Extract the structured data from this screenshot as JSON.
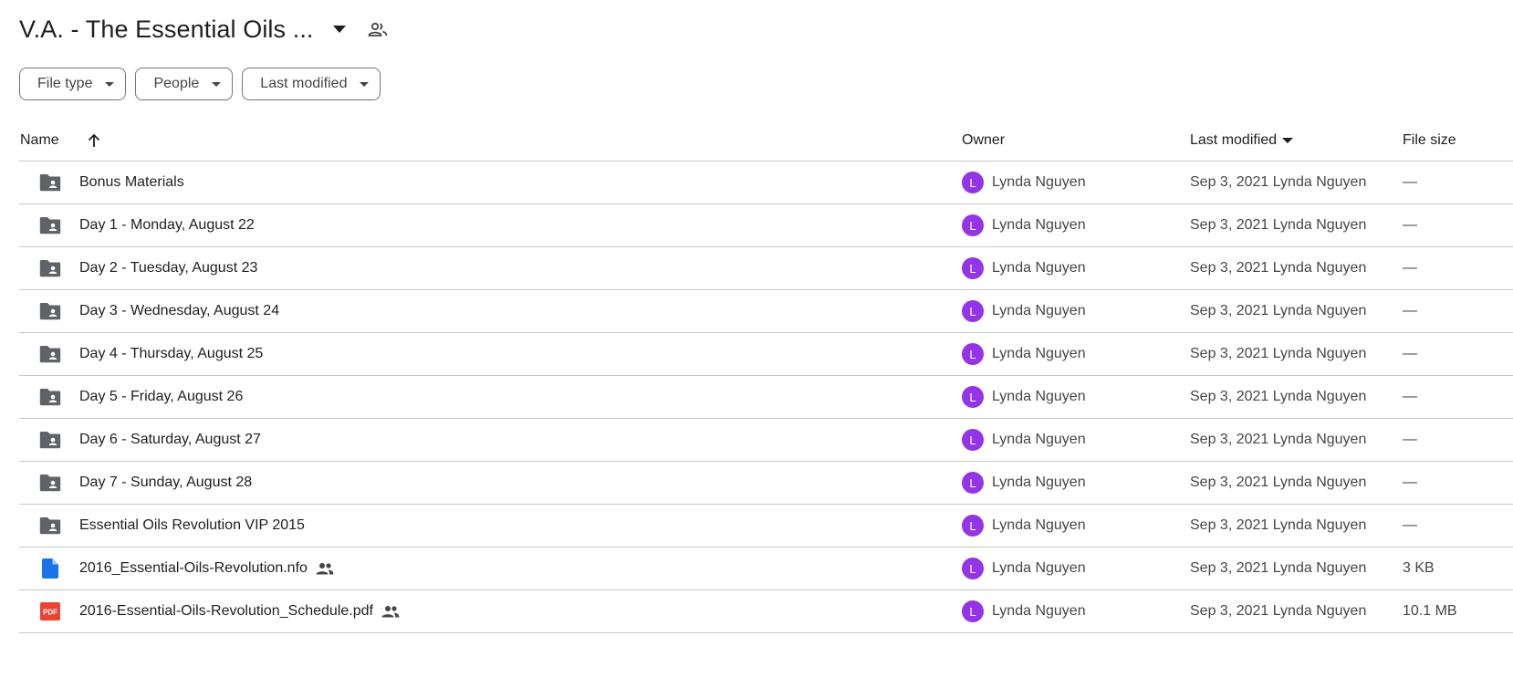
{
  "header": {
    "title": "V.A. - The Essential Oils ...",
    "title_caret_icon": "arrow-drop-down-icon",
    "shared_icon": "people-icon"
  },
  "filters": [
    {
      "label": "File type"
    },
    {
      "label": "People"
    },
    {
      "label": "Last modified"
    }
  ],
  "table": {
    "columns": {
      "name": "Name",
      "owner": "Owner",
      "last_modified": "Last modified",
      "file_size": "File size"
    },
    "rows": [
      {
        "name": "Bonus Materials",
        "type": "shared-folder",
        "shared": false,
        "owner_initial": "L",
        "owner": "Lynda Nguyen",
        "modified": "Sep 3, 2021 Lynda Nguyen",
        "size": "—"
      },
      {
        "name": "Day 1 - Monday, August 22",
        "type": "shared-folder",
        "shared": false,
        "owner_initial": "L",
        "owner": "Lynda Nguyen",
        "modified": "Sep 3, 2021 Lynda Nguyen",
        "size": "—"
      },
      {
        "name": "Day 2 - Tuesday, August 23",
        "type": "shared-folder",
        "shared": false,
        "owner_initial": "L",
        "owner": "Lynda Nguyen",
        "modified": "Sep 3, 2021 Lynda Nguyen",
        "size": "—"
      },
      {
        "name": "Day 3 - Wednesday, August 24",
        "type": "shared-folder",
        "shared": false,
        "owner_initial": "L",
        "owner": "Lynda Nguyen",
        "modified": "Sep 3, 2021 Lynda Nguyen",
        "size": "—"
      },
      {
        "name": "Day 4 - Thursday, August 25",
        "type": "shared-folder",
        "shared": false,
        "owner_initial": "L",
        "owner": "Lynda Nguyen",
        "modified": "Sep 3, 2021 Lynda Nguyen",
        "size": "—"
      },
      {
        "name": "Day 5 - Friday, August 26",
        "type": "shared-folder",
        "shared": false,
        "owner_initial": "L",
        "owner": "Lynda Nguyen",
        "modified": "Sep 3, 2021 Lynda Nguyen",
        "size": "—"
      },
      {
        "name": "Day 6 - Saturday, August 27",
        "type": "shared-folder",
        "shared": false,
        "owner_initial": "L",
        "owner": "Lynda Nguyen",
        "modified": "Sep 3, 2021 Lynda Nguyen",
        "size": "—"
      },
      {
        "name": "Day 7 - Sunday, August 28",
        "type": "shared-folder",
        "shared": false,
        "owner_initial": "L",
        "owner": "Lynda Nguyen",
        "modified": "Sep 3, 2021 Lynda Nguyen",
        "size": "—"
      },
      {
        "name": "Essential Oils Revolution VIP 2015",
        "type": "shared-folder",
        "shared": false,
        "owner_initial": "L",
        "owner": "Lynda Nguyen",
        "modified": "Sep 3, 2021 Lynda Nguyen",
        "size": "—"
      },
      {
        "name": "2016_Essential-Oils-Revolution.nfo",
        "type": "doc",
        "shared": true,
        "owner_initial": "L",
        "owner": "Lynda Nguyen",
        "modified": "Sep 3, 2021 Lynda Nguyen",
        "size": "3 KB"
      },
      {
        "name": "2016-Essential-Oils-Revolution_Schedule.pdf",
        "type": "pdf",
        "shared": true,
        "owner_initial": "L",
        "owner": "Lynda Nguyen",
        "modified": "Sep 3, 2021 Lynda Nguyen",
        "size": "10.1 MB"
      }
    ]
  },
  "colors": {
    "avatar": "#9334e6",
    "folder_icon": "#5f6368",
    "doc_icon": "#1a73e8",
    "pdf_icon": "#ea4335",
    "divider": "#c7c7c7"
  },
  "icons": {
    "sort": "arrow-upward-icon",
    "folder": "shared-folder-icon",
    "doc": "document-icon",
    "pdf": "pdf-icon",
    "shared": "people-icon"
  }
}
